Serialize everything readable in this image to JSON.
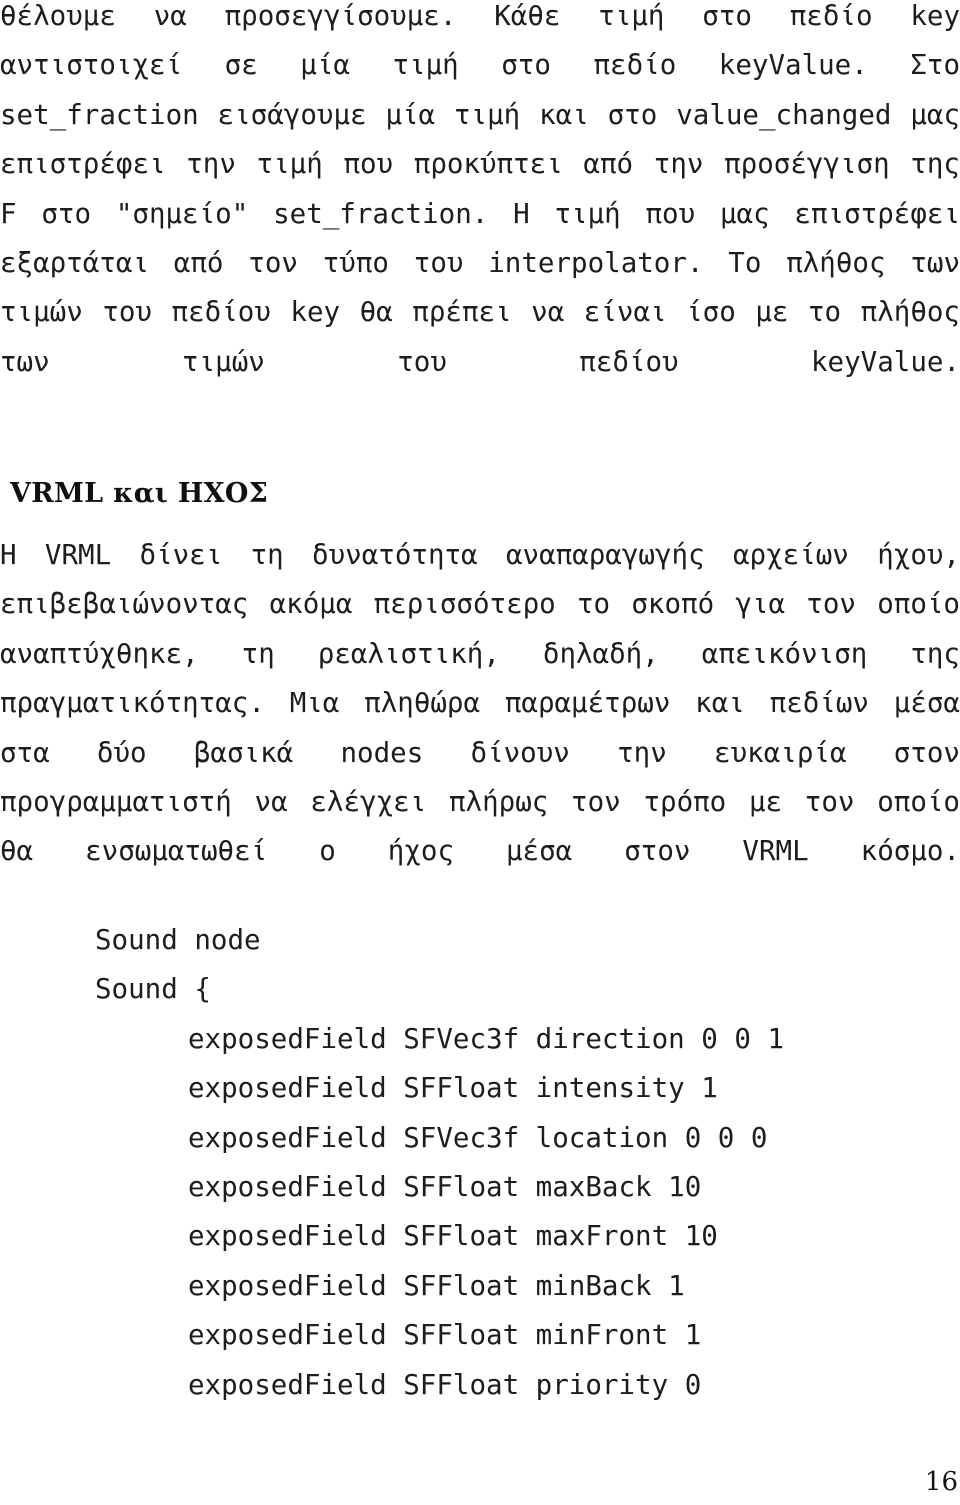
{
  "document": {
    "language": "el",
    "page_number": "16",
    "text_color": "#1d1d1d",
    "background_color": "#ffffff"
  },
  "body": {
    "paragraph_intro": "θέλουμε να προσεγγίσουμε. Κάθε τιμή στο πεδίο key αντιστοιχεί σε μία τιμή στο πεδίο keyValue. Στο set_fraction εισάγουμε μία τιμή και στο value_changed μας επιστρέφει την τιμή που προκύπτει από την προσέγγιση της F στο \"σημείο\" set_fraction. Η τιμή που μας επιστρέφει εξαρτάται από τον τύπο του interpolator. Το πλήθος των τιμών του πεδίου key θα πρέπει να είναι ίσο με το πλήθος των τιμών του πεδίου keyValue.",
    "paragraph_sound_intro": "Η VRML δίνει τη δυνατότητα αναπαραγωγής αρχείων ήχου, επιβεβαιώνοντας ακόμα περισσότερο το σκοπό για τον οποίο αναπτύχθηκε, τη ρεαλιστική, δηλαδή, απεικόνιση της πραγματικότητας. Μια πληθώρα παραμέτρων και πεδίων μέσα στα δύο βασικά nodes δίνουν την ευκαιρία στον προγραμματιστή να ελέγχει πλήρως τον τρόπο με τον οποίο θα ενσωματωθεί ο ήχος μέσα στον VRML κόσμο."
  },
  "heading": {
    "section_title": "VRML και ΗΧΟΣ"
  },
  "code_listing": {
    "lines": [
      {
        "text": "Sound node",
        "indent": 1
      },
      {
        "text": "Sound {",
        "indent": 1
      },
      {
        "text": "exposedField SFVec3f direction 0 0 1",
        "indent": 2
      },
      {
        "text": "exposedField SFFloat intensity 1",
        "indent": 2
      },
      {
        "text": "exposedField SFVec3f location 0 0 0",
        "indent": 2
      },
      {
        "text": "exposedField SFFloat maxBack 10",
        "indent": 2
      },
      {
        "text": "exposedField SFFloat maxFront 10",
        "indent": 2
      },
      {
        "text": "exposedField SFFloat minBack 1",
        "indent": 2
      },
      {
        "text": "exposedField SFFloat minFront 1",
        "indent": 2
      },
      {
        "text": "exposedField SFFloat priority 0",
        "indent": 2
      }
    ]
  }
}
